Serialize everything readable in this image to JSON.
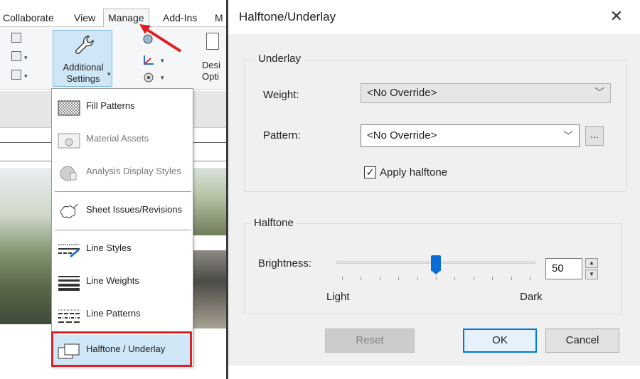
{
  "ribbon": {
    "tabs": [
      "Collaborate",
      "View",
      "Manage",
      "Add-Ins",
      "M"
    ],
    "active_tab": "Manage",
    "additional_settings_label_1": "Additional",
    "additional_settings_label_2": "Settings",
    "design_options_label_1": "Desi",
    "design_options_label_2": "Opti"
  },
  "menu": {
    "items": [
      {
        "label": "Fill Patterns",
        "icon": "fill-pattern-icon",
        "enabled": true
      },
      {
        "label": "Material Assets",
        "icon": "material-assets-icon",
        "enabled": false
      },
      {
        "label": "Analysis Display Styles",
        "icon": "analysis-display-icon",
        "enabled": false
      },
      {
        "label": "Sheet Issues/Revisions",
        "icon": "revision-cloud-icon",
        "enabled": true
      },
      {
        "label": "Line Styles",
        "icon": "line-styles-icon",
        "enabled": true
      },
      {
        "label": "Line Weights",
        "icon": "line-weights-icon",
        "enabled": true
      },
      {
        "label": "Line Patterns",
        "icon": "line-patterns-icon",
        "enabled": true
      },
      {
        "label": "Halftone / Underlay",
        "icon": "halftone-underlay-icon",
        "enabled": true,
        "highlighted": true
      }
    ],
    "highlight_color": "#d8232a"
  },
  "dialog": {
    "title": "Halftone/Underlay",
    "close_glyph": "✕",
    "underlay": {
      "legend": "Underlay",
      "weight_label": "Weight:",
      "weight_value": "<No Override>",
      "pattern_label": "Pattern:",
      "pattern_value": "<No Override>",
      "pattern_more": "...",
      "apply_halftone_label": "Apply halftone",
      "apply_halftone_checked": true
    },
    "halftone": {
      "legend": "Halftone",
      "brightness_label": "Brightness:",
      "brightness_value": "50",
      "slider_fraction": 0.5,
      "light_label": "Light",
      "dark_label": "Dark"
    },
    "buttons": {
      "reset": "Reset",
      "ok": "OK",
      "cancel": "Cancel"
    },
    "accent_color": "#0078d7"
  }
}
